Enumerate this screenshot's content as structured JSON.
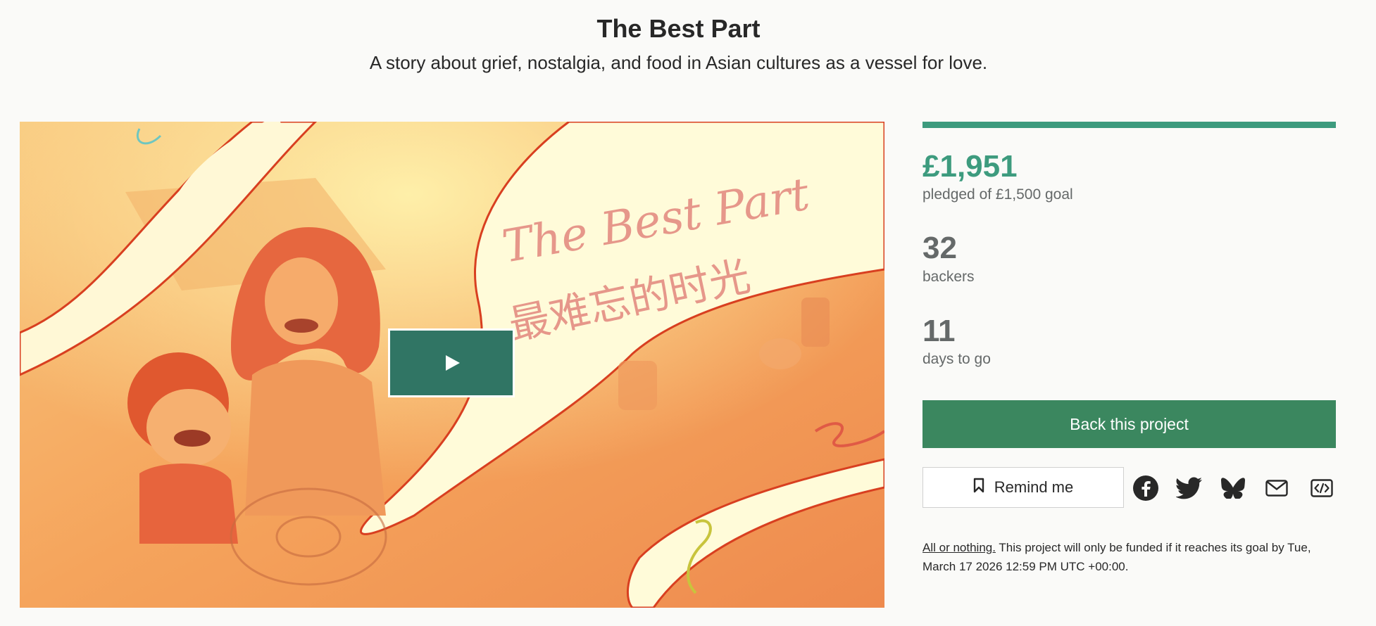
{
  "project": {
    "title": "The Best Part",
    "subtitle": "A story about grief, nostalgia, and food in Asian cultures as a vessel for love."
  },
  "video": {
    "artwork_text": "The Best Part",
    "artwork_text_cn": "最难忘的时光",
    "play_icon": "play-icon"
  },
  "stats": {
    "pledged": "£1,951",
    "pledged_sub": "pledged of £1,500 goal",
    "backers": "32",
    "backers_sub": "backers",
    "days": "11",
    "days_sub": "days to go",
    "funded_fraction": 1.0
  },
  "actions": {
    "back_label": "Back this project",
    "remind_label": "Remind me",
    "share_icons": [
      "facebook-icon",
      "twitter-icon",
      "bluesky-icon",
      "email-icon",
      "embed-icon"
    ]
  },
  "funding_note": {
    "emphasis": "All or nothing.",
    "text": " This project will only be funded if it reaches its goal by Tue, March 17 2026 12:59 PM UTC +00:00."
  },
  "colors": {
    "accent": "#3d9b7e",
    "button": "#3b875f",
    "play_button": "#307564",
    "muted_text": "#656969"
  }
}
